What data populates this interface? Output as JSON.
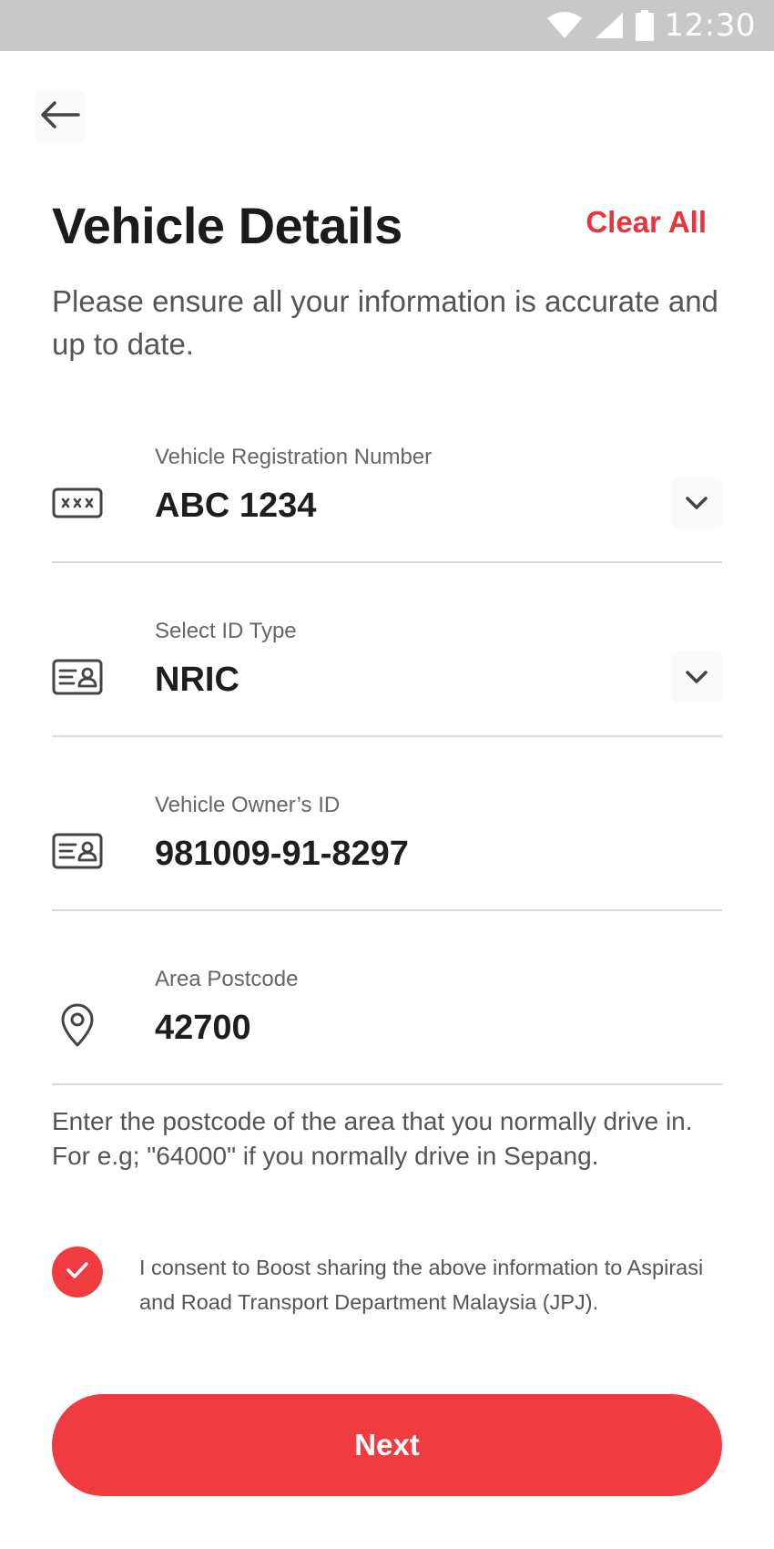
{
  "status_bar": {
    "time": "12:30",
    "icons": [
      "wifi-icon",
      "cell-signal-icon",
      "battery-icon"
    ]
  },
  "header": {
    "back_icon": "arrow-left-icon",
    "title": "Vehicle Details",
    "clear_all_label": "Clear All",
    "subtitle": "Please ensure all your information is accurate and up to date."
  },
  "fields": [
    {
      "icon": "license-plate-icon",
      "label": "Vehicle Registration Number",
      "value": "ABC 1234",
      "dropdown": true
    },
    {
      "icon": "id-card-icon",
      "label": "Select ID Type",
      "value": "NRIC",
      "dropdown": true
    },
    {
      "icon": "id-card-icon",
      "label": "Vehicle Owner’s ID",
      "value": "981009-91-8297",
      "dropdown": false
    },
    {
      "icon": "location-pin-icon",
      "label": "Area Postcode",
      "value": "42700",
      "dropdown": false
    }
  ],
  "postcode_hint": "Enter the postcode of the area that you normally drive in.  For e.g; \"64000\" if you normally drive in Sepang.",
  "consent": {
    "checked": true,
    "text": "I consent to Boost sharing the above information to Aspirasi and Road Transport Department Malaysia (JPJ)."
  },
  "next_label": "Next",
  "colors": {
    "accent": "#f03c40",
    "accent_text": "#e8353c",
    "status_bar": "#c8c8c8",
    "divider": "#d9d9d9"
  }
}
